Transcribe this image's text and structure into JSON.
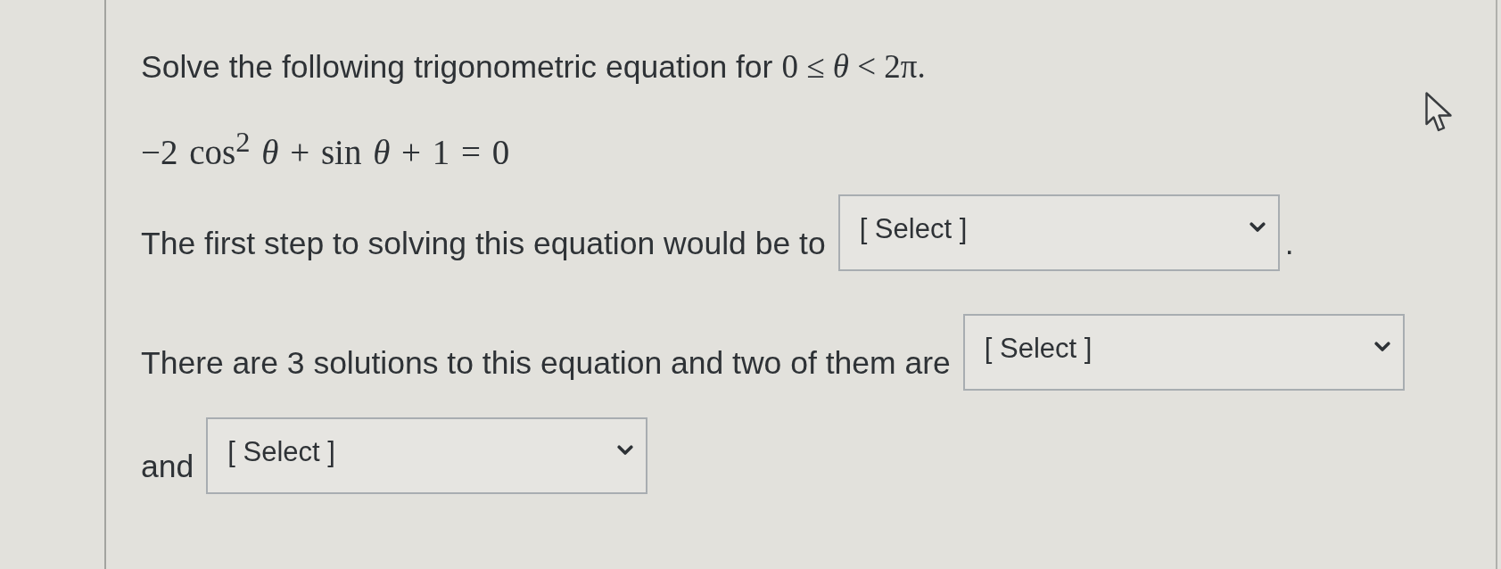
{
  "question": {
    "prompt": "Solve the following trigonometric equation for",
    "condition": "0 ≤ *θ* < 2π.",
    "equation": "−2 cos$^{2}$ *θ* + sin *θ* + 1 = 0"
  },
  "blanks": [
    {
      "before": "The first step to solving this equation would be to",
      "value": "[ Select ]",
      "after": "."
    },
    {
      "before": "There are 3 solutions to this equation and two of them are",
      "value": "[ Select ]"
    },
    {
      "before": "and",
      "value": "[ Select ]"
    }
  ]
}
